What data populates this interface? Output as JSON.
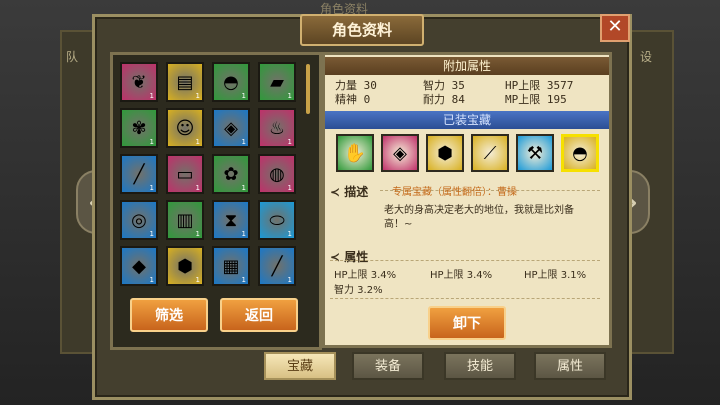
{
  "dialog": {
    "title": "角色资料",
    "close_icon": "close-icon",
    "background_title": "角色资料"
  },
  "background": {
    "left_tag": "队",
    "right_tag": "设"
  },
  "treasure_grid": {
    "slots": [
      {
        "icon": "green-leaf-icon",
        "color": "#c0306a",
        "count": "1"
      },
      {
        "icon": "book-icon",
        "color": "#d8b020",
        "count": "1"
      },
      {
        "icon": "hat-icon",
        "color": "#2f9a3a",
        "count": "1"
      },
      {
        "icon": "red-brick-icon",
        "color": "#2f9a3a",
        "count": "1"
      },
      {
        "icon": "coral-icon",
        "color": "#2f9a3a",
        "count": "1"
      },
      {
        "icon": "doll-icon",
        "color": "#d8b020",
        "count": "1"
      },
      {
        "icon": "red-cloth-icon",
        "color": "#1a78c8",
        "count": "1"
      },
      {
        "icon": "pig-icon",
        "color": "#c0306a",
        "count": "1"
      },
      {
        "icon": "stick-icon",
        "color": "#1a78c8",
        "count": "1"
      },
      {
        "icon": "blue-cloth-icon",
        "color": "#c0306a",
        "count": "1"
      },
      {
        "icon": "rabbit-icon",
        "color": "#2f9a3a",
        "count": "1"
      },
      {
        "icon": "shell-icon",
        "color": "#c0306a",
        "count": "1"
      },
      {
        "icon": "ring-icon",
        "color": "#1a78c8",
        "count": "1"
      },
      {
        "icon": "scroll-icon",
        "color": "#2f9a3a",
        "count": "1"
      },
      {
        "icon": "hourglass-icon",
        "color": "#1a78c8",
        "count": "1"
      },
      {
        "icon": "gold-bar-icon",
        "color": "#1a9ad8",
        "count": "1"
      },
      {
        "icon": "gem-icon",
        "color": "#1a78c8",
        "count": "1"
      },
      {
        "icon": "turtle-icon",
        "color": "#d8b020",
        "count": "1"
      },
      {
        "icon": "cage-icon",
        "color": "#1a78c8",
        "count": "1"
      },
      {
        "icon": "stick-icon",
        "color": "#1a78c8",
        "count": "1"
      }
    ],
    "filter_label": "筛选",
    "back_label": "返回"
  },
  "attributes": {
    "header": "附加属性",
    "stats": [
      {
        "label": "力量",
        "value": "30"
      },
      {
        "label": "智力",
        "value": "35"
      },
      {
        "label": "HP上限",
        "value": "3577"
      },
      {
        "label": "精神",
        "value": "0"
      },
      {
        "label": "耐力",
        "value": "84"
      },
      {
        "label": "MP上限",
        "value": "195"
      }
    ],
    "equipped_header": "已装宝藏"
  },
  "equipped": [
    {
      "icon": "hand-icon",
      "color": "#2f9a3a"
    },
    {
      "icon": "red-cloth-icon",
      "color": "#c0306a"
    },
    {
      "icon": "turtle-icon",
      "color": "#d8b020"
    },
    {
      "icon": "branch-icon",
      "color": "#d8b020"
    },
    {
      "icon": "wrench-icon",
      "color": "#1a9ad8"
    },
    {
      "icon": "red-hat-icon",
      "color": "#d8b020"
    }
  ],
  "description": {
    "title": "描述",
    "name": "专属宝藏（属性翻倍）：曹操",
    "text": "老大的身高决定老大的地位，我就是比刘备高！~"
  },
  "properties": {
    "title": "属性",
    "items": [
      "HP上限 3.4%",
      "HP上限 3.4%",
      "HP上限 3.1%",
      "智力   3.2%"
    ]
  },
  "unequip_label": "卸下",
  "tabs": [
    {
      "label": "宝藏",
      "active": true
    },
    {
      "label": "装备",
      "active": false
    },
    {
      "label": "技能",
      "active": false
    },
    {
      "label": "属性",
      "active": false
    }
  ]
}
